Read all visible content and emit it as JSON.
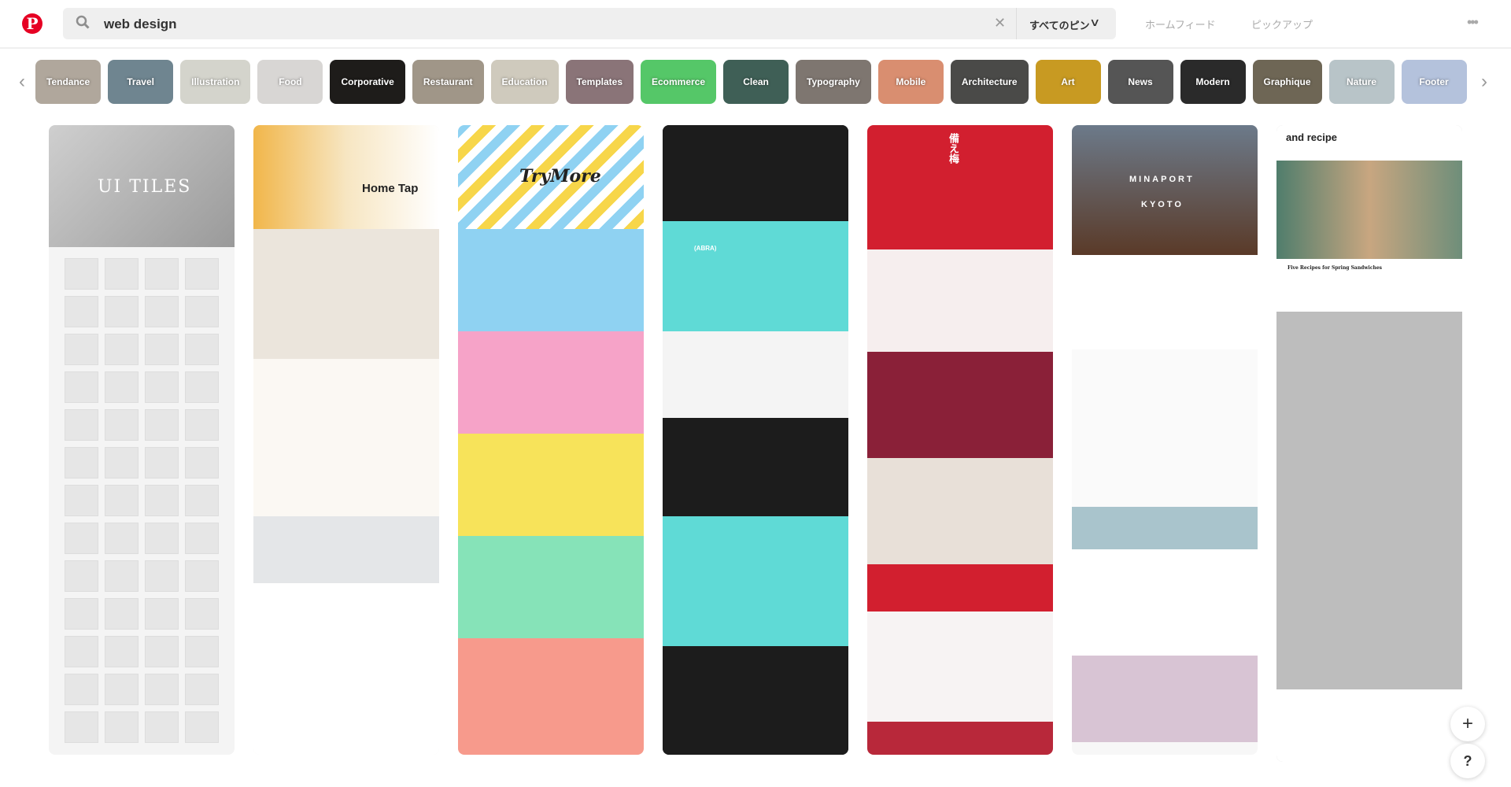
{
  "header": {
    "logo": "P",
    "search_value": "web design",
    "clear": "✕",
    "scope": "すべてのピン",
    "nav": [
      "ホームフィード",
      "ピックアップ"
    ],
    "more": "•••"
  },
  "categories": [
    {
      "label": "Tendance",
      "color": "#b0a79c"
    },
    {
      "label": "Travel",
      "color": "#6f8590"
    },
    {
      "label": "Illustration",
      "color": "#d4d4cc"
    },
    {
      "label": "Food",
      "color": "#d8d6d4"
    },
    {
      "label": "Corporative",
      "color": "#1e1c1a"
    },
    {
      "label": "Restaurant",
      "color": "#a09688"
    },
    {
      "label": "Education",
      "color": "#cfcabd"
    },
    {
      "label": "Templates",
      "color": "#8a7478"
    },
    {
      "label": "Ecommerce",
      "color": "#55c768"
    },
    {
      "label": "Clean",
      "color": "#3f5f56"
    },
    {
      "label": "Typography",
      "color": "#7e7670"
    },
    {
      "label": "Mobile",
      "color": "#d98e70"
    },
    {
      "label": "Architecture",
      "color": "#4a4a48"
    },
    {
      "label": "Art",
      "color": "#c89a22"
    },
    {
      "label": "News",
      "color": "#555"
    },
    {
      "label": "Modern",
      "color": "#2a2a2a"
    },
    {
      "label": "Graphique",
      "color": "#6e6655"
    },
    {
      "label": "Nature",
      "color": "#b8c4c8"
    },
    {
      "label": "Footer",
      "color": "#b4c2dc"
    }
  ],
  "pins": [
    {
      "title": "UI TILES"
    },
    {
      "title": "Home Tap"
    },
    {
      "title": "TryMore"
    },
    {
      "title": "(ABRA)"
    },
    {
      "title": "備え梅"
    },
    {
      "title": "MINAPORT",
      "subtitle": "KYOTO"
    },
    {
      "title": "and recipe",
      "subtitle": "Five Recipes for Spring Sandwiches"
    }
  ],
  "fab": {
    "add": "+",
    "help": "?"
  }
}
